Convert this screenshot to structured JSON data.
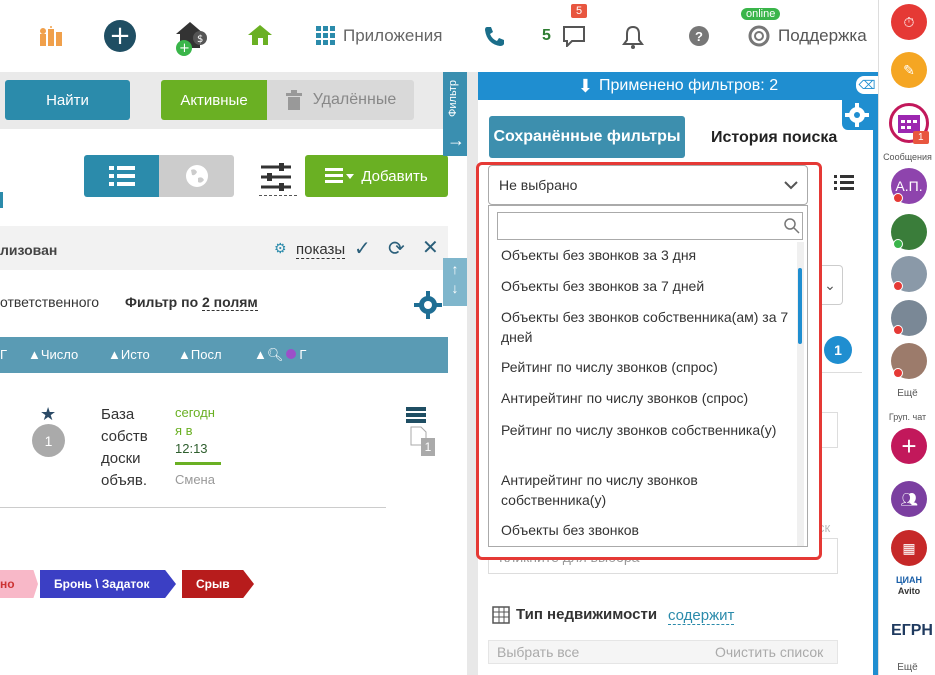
{
  "topbar": {
    "apps_label": "Приложения",
    "calls_count": "5",
    "messages_badge": "5",
    "online_badge": "online",
    "support_label": "Поддержка"
  },
  "left": {
    "find_button": "Найти",
    "active_tab": "Активные",
    "deleted_tab": "Удалённые",
    "add_button": "Добавить",
    "status_text": "лизован",
    "shows_link": "показы",
    "responsible_text": "ответственного",
    "filter_by_label": "Фильтр по",
    "filter_fields_link": "2 полям",
    "columns": [
      "Г",
      "Число",
      "Исто",
      "Посл",
      "Г"
    ],
    "row": {
      "count": "1",
      "text_lines": [
        "База",
        "собств",
        "доски",
        "объяв."
      ],
      "date_lines": [
        "сегодн",
        "я в",
        "12:13"
      ],
      "change_text": "Смена",
      "doc_count": "1"
    },
    "tags": [
      "но",
      "Бронь \\ Задаток",
      "Срыв"
    ]
  },
  "right": {
    "filters_applied": "Применено фильтров: 2",
    "saved_filters_tab": "Сохранённые фильтры",
    "search_history_tab": "История поиска",
    "select_value": "Не выбрано",
    "search_placeholder": "",
    "options": [
      "Объекты без звонков за 3 дня",
      "Объекты без звонков за 7 дней",
      "Объекты без звонков собственника(ам) за 7 дней",
      "Рейтинг по числу звонков (спрос)",
      "Антирейтинг по числу звонков (спрос)",
      "Рейтинг по числу звонков собственника(у)",
      "Антирейтинг по числу звонков собственника(у)",
      "Объекты без звонков"
    ],
    "counter_badge": "1",
    "click_to_choose": "Кликните для выбора",
    "partial_clear": "ск",
    "property_type_label": "Тип недвижимости",
    "contains_link": "содержит",
    "select_all": "Выбрать все",
    "clear_list": "Очистить список"
  },
  "sidebar": {
    "messages_badge": "1",
    "messages_label": "Сообщения",
    "avatar_initials": "А.П.",
    "more_label_1": "Ещё",
    "group_chat_label": "Груп. чат",
    "cian_label": "ЦИАН",
    "avito_label": "Avito",
    "egrn_label": "ЕГРН",
    "more_label_2": "Ещё"
  }
}
